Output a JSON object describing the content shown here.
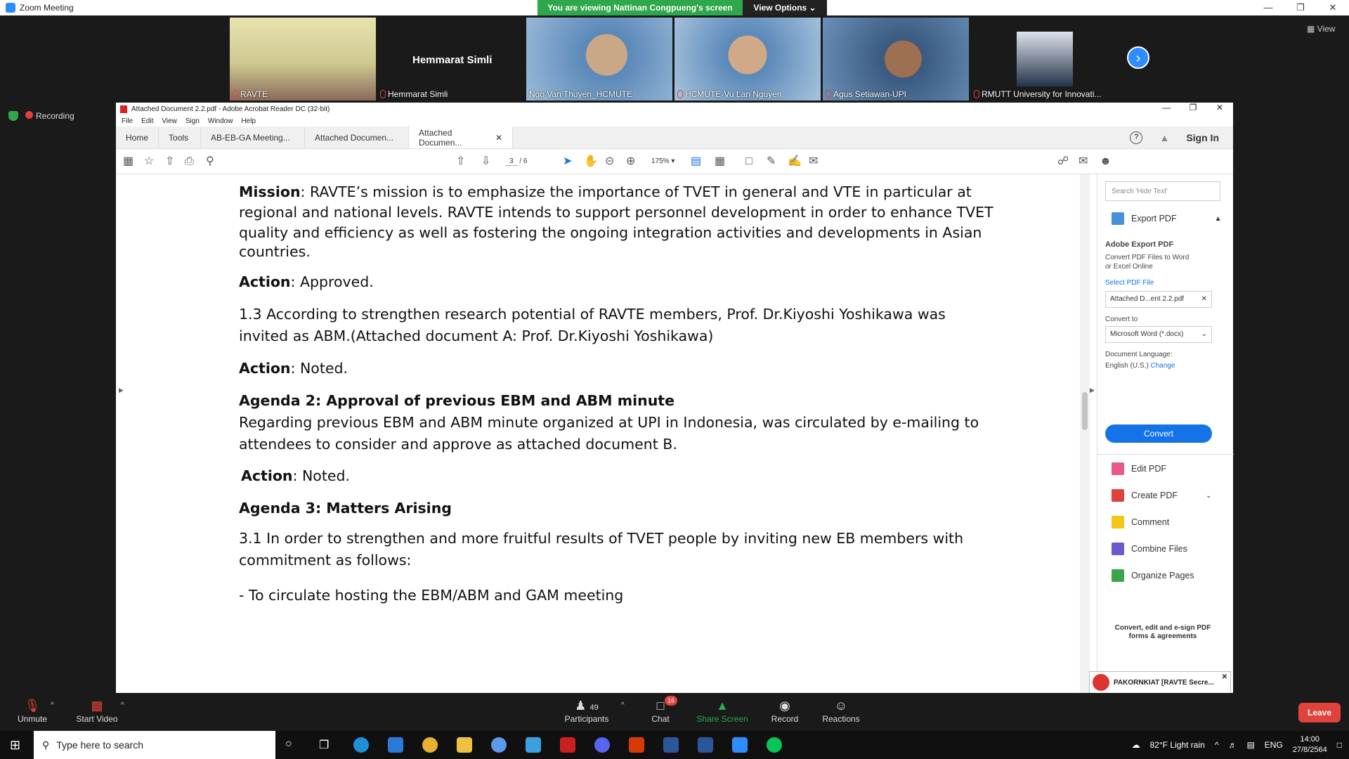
{
  "zoom": {
    "window_title": "Zoom Meeting",
    "banner_text": "You are viewing Nattinan Congpueng's screen",
    "view_options": "View Options",
    "view_label": "View",
    "recording": "Recording",
    "participants_tiles": [
      {
        "name": "RAVTE"
      },
      {
        "name": "Hemmarat Simli"
      },
      {
        "name": "Ngo Van Thuyen_HCMUTE"
      },
      {
        "name": "HCMUTE-Vu Lan Nguyen"
      },
      {
        "name": "Agus Setiawan-UPI"
      },
      {
        "name": "RMUTT University for Innovati..."
      }
    ],
    "active_speaker_name": "Hemmarat Simli",
    "bottom": {
      "unmute": "Unmute",
      "start_video": "Start Video",
      "participants": "Participants",
      "participants_count": "49",
      "chat": "Chat",
      "chat_badge": "16",
      "share_screen": "Share Screen",
      "record": "Record",
      "reactions": "Reactions",
      "leave": "Leave"
    },
    "chat_popup": "PAKORNKIAT [RAVTE Secre..."
  },
  "acrobat": {
    "title": "Attached Document 2.2.pdf - Adobe Acrobat Reader DC (32-bit)",
    "menu": [
      "File",
      "Edit",
      "View",
      "Sign",
      "Window",
      "Help"
    ],
    "tabs": [
      {
        "label": "Home"
      },
      {
        "label": "Tools"
      },
      {
        "label": "AB-EB-GA Meeting..."
      },
      {
        "label": "Attached Documen..."
      },
      {
        "label": "Attached Documen..."
      }
    ],
    "sign_in": "Sign In",
    "page_current": "3",
    "page_total": "/ 6",
    "zoom": "175%",
    "document": {
      "mission_head": "Mission",
      "mission_l1": ": RAVTE’s mission is to emphasize the importance of TVET in general and VTE in particular at",
      "mission_l2": "regional and national levels. RAVTE intends to support personnel development in order to enhance TVET",
      "mission_l3": "quality and efficiency as well as fostering the ongoing integration activities and developments in Asian",
      "mission_l4": "countries.",
      "action_head": "Action",
      "action1": ":  Approved.",
      "item13_l1": "1.3 According to strengthen research potential of RAVTE members, Prof. Dr.Kiyoshi Yoshikawa was",
      "item13_l2": "invited as ABM.(Attached document A: Prof. Dr.Kiyoshi Yoshikawa)",
      "action2": ":  Noted.",
      "agenda2": "Agenda 2: Approval of previous EBM and ABM minute",
      "agenda2_l1": "Regarding  previous EBM and ABM minute organized at UPI in Indonesia, was circulated by e-mailing to",
      "agenda2_l2": "attendees to consider and approve as attached document B.",
      "action3": ":  Noted.",
      "agenda3": "Agenda 3: Matters Arising",
      "item31_l1": "3.1 In order to strengthen and more fruitful results of TVET people by inviting new EB members with",
      "item31_l2": "commitment as follows:",
      "item31_l3": "- To circulate hosting the EBM/ABM and GAM meeting"
    },
    "right_pane": {
      "search_placeholder": "Search 'Hide Text'",
      "export_pdf": "Export PDF",
      "adobe_export_title": "Adobe Export PDF",
      "adobe_export_desc1": "Convert PDF Files to Word",
      "adobe_export_desc2": "or Excel Online",
      "select_pdf_file": "Select PDF File",
      "selected_file": "Attached D...ent 2.2.pdf",
      "convert_to": "Convert to",
      "convert_format": "Microsoft Word (*.docx)",
      "doc_language": "Document Language:",
      "language": "English (U.S.)",
      "change": "Change",
      "convert_button": "Convert",
      "tools": [
        "Edit PDF",
        "Create PDF",
        "Comment",
        "Combine Files",
        "Organize Pages"
      ],
      "promo1": "Convert, edit and e-sign PDF",
      "promo2": "forms & agreements"
    }
  },
  "taskbar": {
    "search_placeholder": "Type here to search",
    "weather": "82°F  Light rain",
    "lang": "ENG",
    "time": "14:00",
    "date": "27/8/2564"
  },
  "colors": {
    "zoom_green": "#2ea84a",
    "zoom_blue": "#2d8cff",
    "adobe_blue": "#1473e6",
    "leave_red": "#e0433b"
  }
}
